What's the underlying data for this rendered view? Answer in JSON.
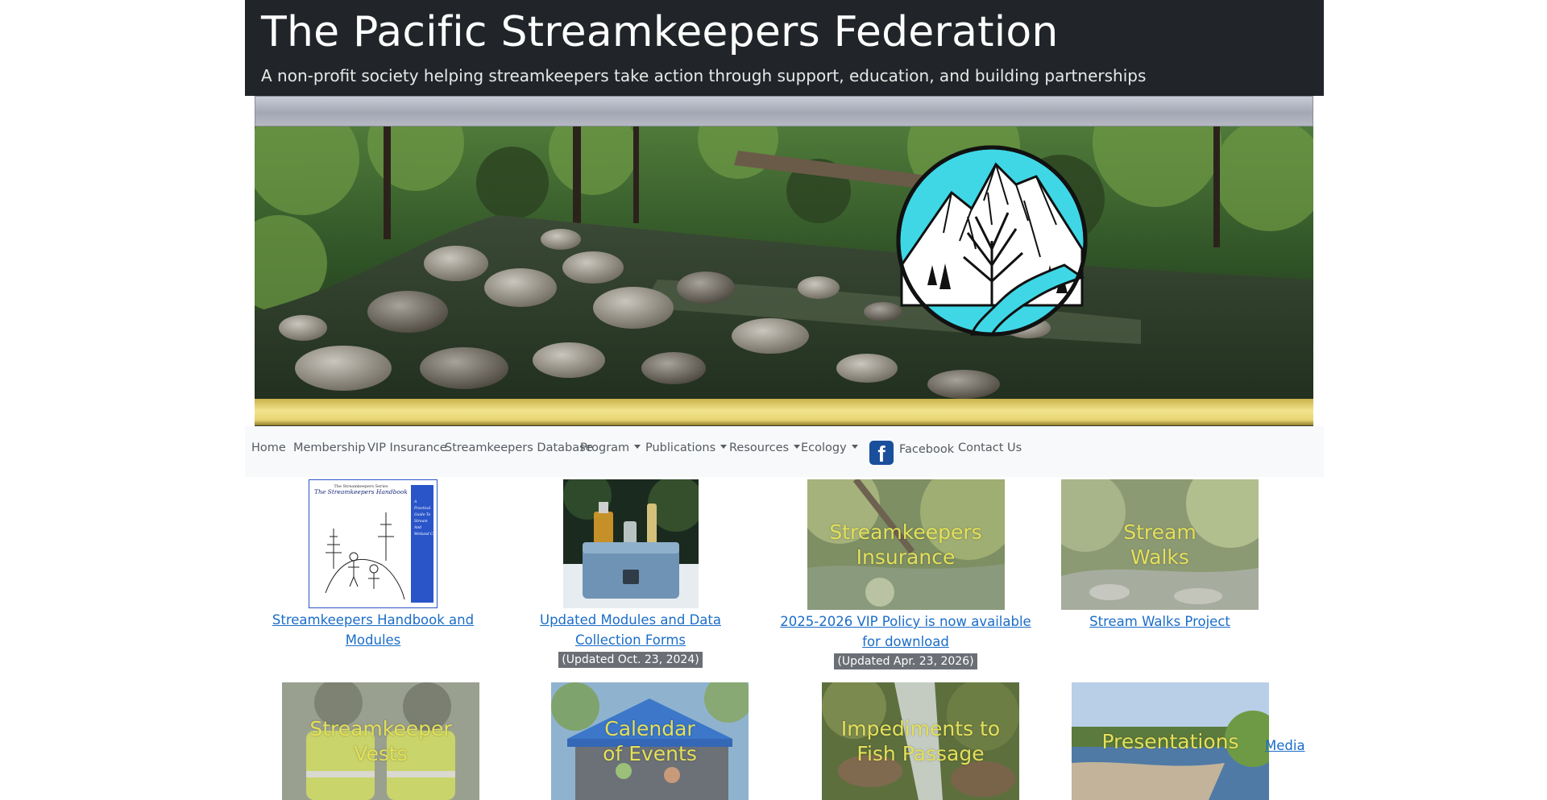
{
  "header": {
    "title": "The Pacific Streamkeepers Federation",
    "tagline": "A non-profit society helping streamkeepers take action through support, education, and building partnerships"
  },
  "banner": {
    "photo": "forest-stream-rocks",
    "logo": "mountain-tree-river-circle-logo"
  },
  "nav": {
    "items": [
      {
        "label": "Home"
      },
      {
        "label": "Membership"
      },
      {
        "label": "VIP Insurance"
      },
      {
        "label": "Streamkeepers Database"
      },
      {
        "label": "Program",
        "dropdown": true
      },
      {
        "label": "Publications",
        "dropdown": true
      },
      {
        "label": "Resources",
        "dropdown": true
      },
      {
        "label": "Ecology",
        "dropdown": true
      },
      {
        "label": "Facebook",
        "icon": "facebook-icon"
      },
      {
        "label": "Contact Us"
      }
    ]
  },
  "tiles": {
    "row1": [
      {
        "link": "Streamkeepers Handbook and Modules",
        "image": "handbook-cover",
        "handbook_cover": {
          "series": "The Streamkeepers Series",
          "title": "The Streamkeepers Handbook",
          "subtitle": "A Practical Guide To Stream And Wetland Care"
        }
      },
      {
        "link": "Updated Modules and Data Collection Forms",
        "badge": "(Updated Oct. 23, 2024)",
        "image": "water-test-kit-photo"
      },
      {
        "link": "2025-2026 VIP Policy is now available for download",
        "badge": "(Updated Apr. 23, 2026)",
        "image_label": "Streamkeepers Insurance"
      },
      {
        "link": "Stream Walks Project",
        "image_label": "Stream Walks"
      }
    ],
    "row2": [
      {
        "image_label": "Streamkeeper Vests"
      },
      {
        "image_label": "Calendar of Events"
      },
      {
        "image_label": "Impediments to Fish Passage"
      },
      {
        "image_label": "Presentations"
      }
    ],
    "media_link": "Media"
  },
  "colors": {
    "header_bg": "#212529",
    "nav_bg": "#f8f9fa",
    "link": "#1a6dc9",
    "badge_bg": "#6b6f75",
    "tile_label": "#e4e05a"
  }
}
